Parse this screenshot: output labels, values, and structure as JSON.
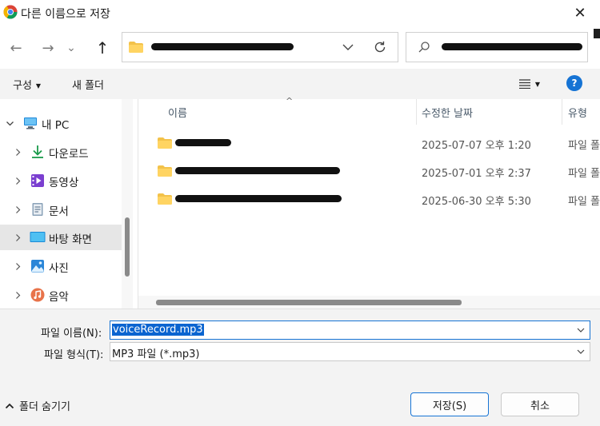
{
  "window": {
    "title": "다른 이름으로 저장",
    "close_glyph": "✕"
  },
  "nav": {
    "back_glyph": "←",
    "forward_glyph": "→",
    "recent_glyph": "⌄",
    "up_glyph": "↑",
    "address_value": "",
    "search_value": ""
  },
  "commands": {
    "organize_label": "구성",
    "new_folder_label": "새 폴더",
    "help_label": "?"
  },
  "tree": [
    {
      "label": "내 PC",
      "icon": "pc-icon",
      "expanded": true
    },
    {
      "label": "다운로드",
      "icon": "download-icon"
    },
    {
      "label": "동영상",
      "icon": "video-icon"
    },
    {
      "label": "문서",
      "icon": "document-icon"
    },
    {
      "label": "바탕 화면",
      "icon": "desktop-icon",
      "selected": true
    },
    {
      "label": "사진",
      "icon": "pictures-icon"
    },
    {
      "label": "음악",
      "icon": "music-icon"
    }
  ],
  "columns": {
    "name": "이름",
    "date": "수정한 날짜",
    "type": "유형"
  },
  "files": [
    {
      "name": "",
      "date": "2025-07-07 오후 1:20",
      "type": "파일 폴더"
    },
    {
      "name": "",
      "date": "2025-07-01 오후 2:37",
      "type": "파일 폴더"
    },
    {
      "name": "",
      "date": "2025-06-30 오후 5:30",
      "type": "파일 폴더"
    }
  ],
  "form": {
    "filename_label": "파일 이름(N):",
    "filename_value": "voiceRecord.mp3",
    "filetype_label": "파일 형식(T):",
    "filetype_value": "MP3 파일 (*.mp3)"
  },
  "footer": {
    "hide_folders_label": "폴더 숨기기",
    "save_label": "저장(S)",
    "cancel_label": "취소"
  },
  "colors": {
    "accent": "#1573d4",
    "selection": "#0a64d0",
    "folder": "#f3c24a"
  }
}
